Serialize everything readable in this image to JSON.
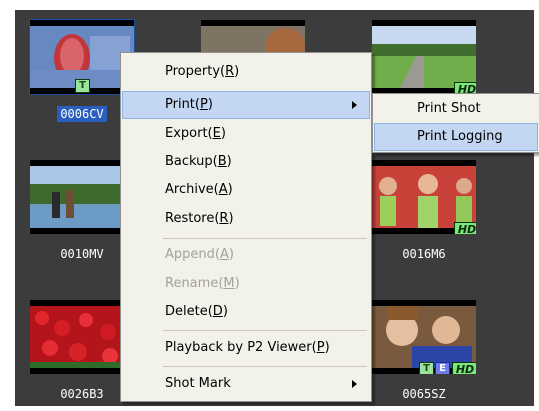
{
  "clips": [
    {
      "id": "0006CV",
      "selected": true,
      "badges": [
        "T"
      ],
      "hd": false
    },
    {
      "id": "",
      "selected": false,
      "badges": [],
      "hd": false
    },
    {
      "id": "",
      "selected": false,
      "badges": [],
      "hd": true,
      "hd_label": "HD"
    },
    {
      "id": "0010MV",
      "selected": false,
      "badges": [],
      "hd": false
    },
    {
      "id": "0016M6",
      "selected": false,
      "badges": [],
      "hd": true,
      "hd_label": "HD"
    },
    {
      "id": "0026B3",
      "selected": false,
      "badges": [],
      "hd": false
    },
    {
      "id": "0065SZ",
      "selected": false,
      "badges": [
        "T",
        "E"
      ],
      "hd": true,
      "hd_label": "HD"
    }
  ],
  "badge_labels": {
    "t": "T",
    "e": "E",
    "hd": "HD"
  },
  "context_menu": {
    "items": [
      {
        "label": "Property(R)",
        "state": "normal"
      },
      {
        "label": "Print(P)",
        "state": "highlighted",
        "submenu": true
      },
      {
        "label": "Export(E)",
        "state": "normal"
      },
      {
        "label": "Backup(B)",
        "state": "normal"
      },
      {
        "label": "Archive(A)",
        "state": "normal"
      },
      {
        "label": "Restore(R)",
        "state": "normal"
      },
      {
        "label": "Append(A)",
        "state": "disabled"
      },
      {
        "label": "Rename(M)",
        "state": "disabled"
      },
      {
        "label": "Delete(D)",
        "state": "normal"
      },
      {
        "label": "Playback by P2 Viewer(P)",
        "state": "normal"
      },
      {
        "label": "Shot Mark",
        "state": "normal",
        "submenu": true
      }
    ]
  },
  "print_submenu": {
    "items": [
      {
        "label": "Print Shot",
        "state": "normal"
      },
      {
        "label": "Print Logging",
        "state": "highlighted"
      }
    ]
  },
  "colors": {
    "browser_bg": "#3c3c3c",
    "menu_bg": "#f3f2ea",
    "highlight": "#c3d6f2",
    "selected_label": "#2a5fbf",
    "badge_green": "#9be59b",
    "badge_blue": "#6d7cf0"
  }
}
